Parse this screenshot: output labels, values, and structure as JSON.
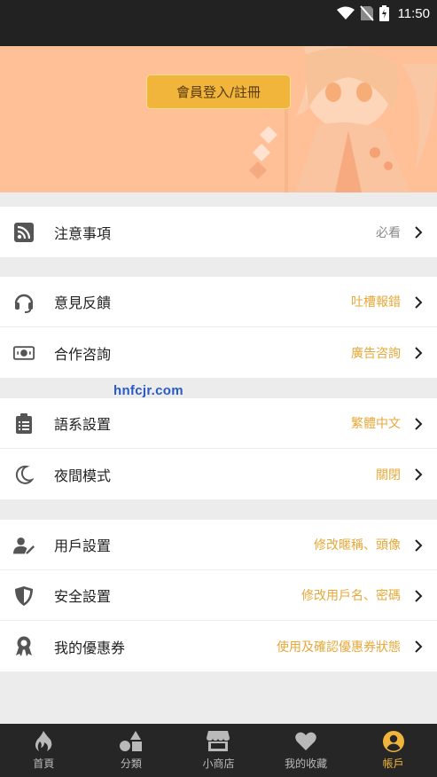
{
  "status_bar": {
    "time": "11:50"
  },
  "banner": {
    "login_label": "會員登入/註冊"
  },
  "menu": {
    "group1": [
      {
        "label": "注意事項",
        "value": "必看",
        "icon": "rss-icon"
      }
    ],
    "group2": [
      {
        "label": "意見反饋",
        "value": "吐槽報錯",
        "icon": "headset-icon"
      },
      {
        "label": "合作咨詢",
        "value": "廣告咨詢",
        "icon": "money-icon"
      }
    ],
    "group3": [
      {
        "label": "語系設置",
        "value": "繁體中文",
        "icon": "clipboard-icon"
      },
      {
        "label": "夜間模式",
        "value": "關閉",
        "icon": "moon-icon"
      }
    ],
    "group4": [
      {
        "label": "用戶設置",
        "value": "修改暱稱、頭像",
        "icon": "user-edit-icon"
      },
      {
        "label": "安全設置",
        "value": "修改用戶名、密碼",
        "icon": "shield-icon"
      },
      {
        "label": "我的優惠券",
        "value": "使用及確認優惠券狀態",
        "icon": "award-icon"
      }
    ]
  },
  "watermark": "hnfcjr.com",
  "tabbar": [
    {
      "label": "首頁",
      "icon": "flame-icon"
    },
    {
      "label": "分類",
      "icon": "shapes-icon"
    },
    {
      "label": "小商店",
      "icon": "store-icon"
    },
    {
      "label": "我的收藏",
      "icon": "heart-icon"
    },
    {
      "label": "帳戶",
      "icon": "user-circle-icon"
    }
  ],
  "colors": {
    "accent": "#f0b53a",
    "banner": "#ffbf97",
    "value_text": "#e7a83a"
  }
}
